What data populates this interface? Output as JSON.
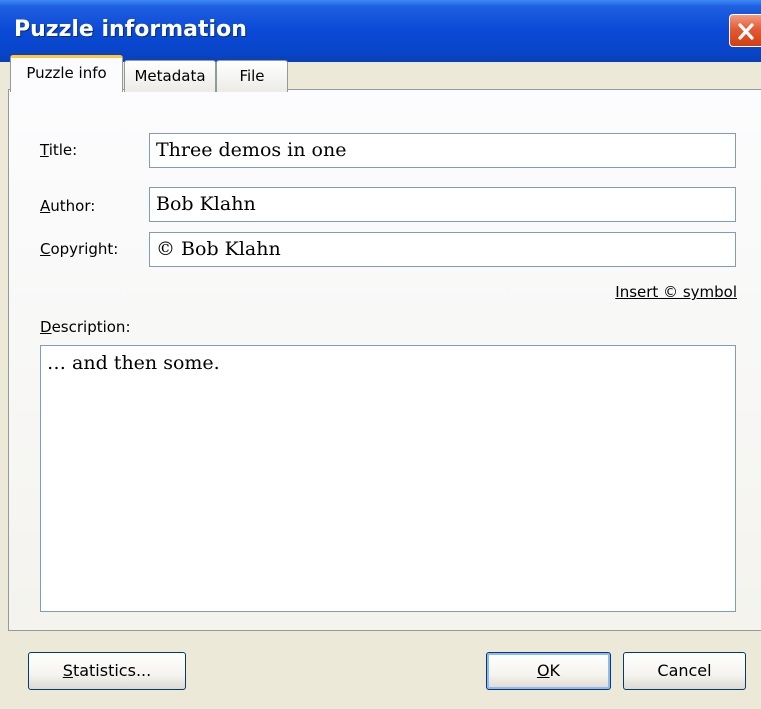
{
  "window": {
    "title": "Puzzle information"
  },
  "tabs": [
    {
      "label": "Puzzle info",
      "active": true
    },
    {
      "label": "Metadata",
      "active": false
    },
    {
      "label": "File",
      "active": false
    }
  ],
  "form": {
    "title_label_mnemonic": "T",
    "title_label_rest": "itle:",
    "title_value": "Three demos in one",
    "author_label_mnemonic": "A",
    "author_label_rest": "uthor:",
    "author_value": "Bob Klahn",
    "copyright_label_mnemonic": "C",
    "copyright_label_rest": "opyright:",
    "copyright_value": "© Bob Klahn",
    "insert_symbol_link": "Insert © symbol",
    "description_label_mnemonic": "D",
    "description_label_rest": "escription:",
    "description_value": "… and then some."
  },
  "buttons": {
    "statistics_mnemonic": "S",
    "statistics_rest": "tatistics...",
    "ok_mnemonic": "O",
    "ok_rest": "K",
    "cancel": "Cancel"
  },
  "colors": {
    "titlebar": "#0a49d6",
    "dialog_background": "#ece9d8",
    "close_button": "#e35b35",
    "active_tab_highlight": "#ffc83c",
    "field_border": "#7f9db9"
  },
  "icons": {
    "close": "close-icon"
  }
}
